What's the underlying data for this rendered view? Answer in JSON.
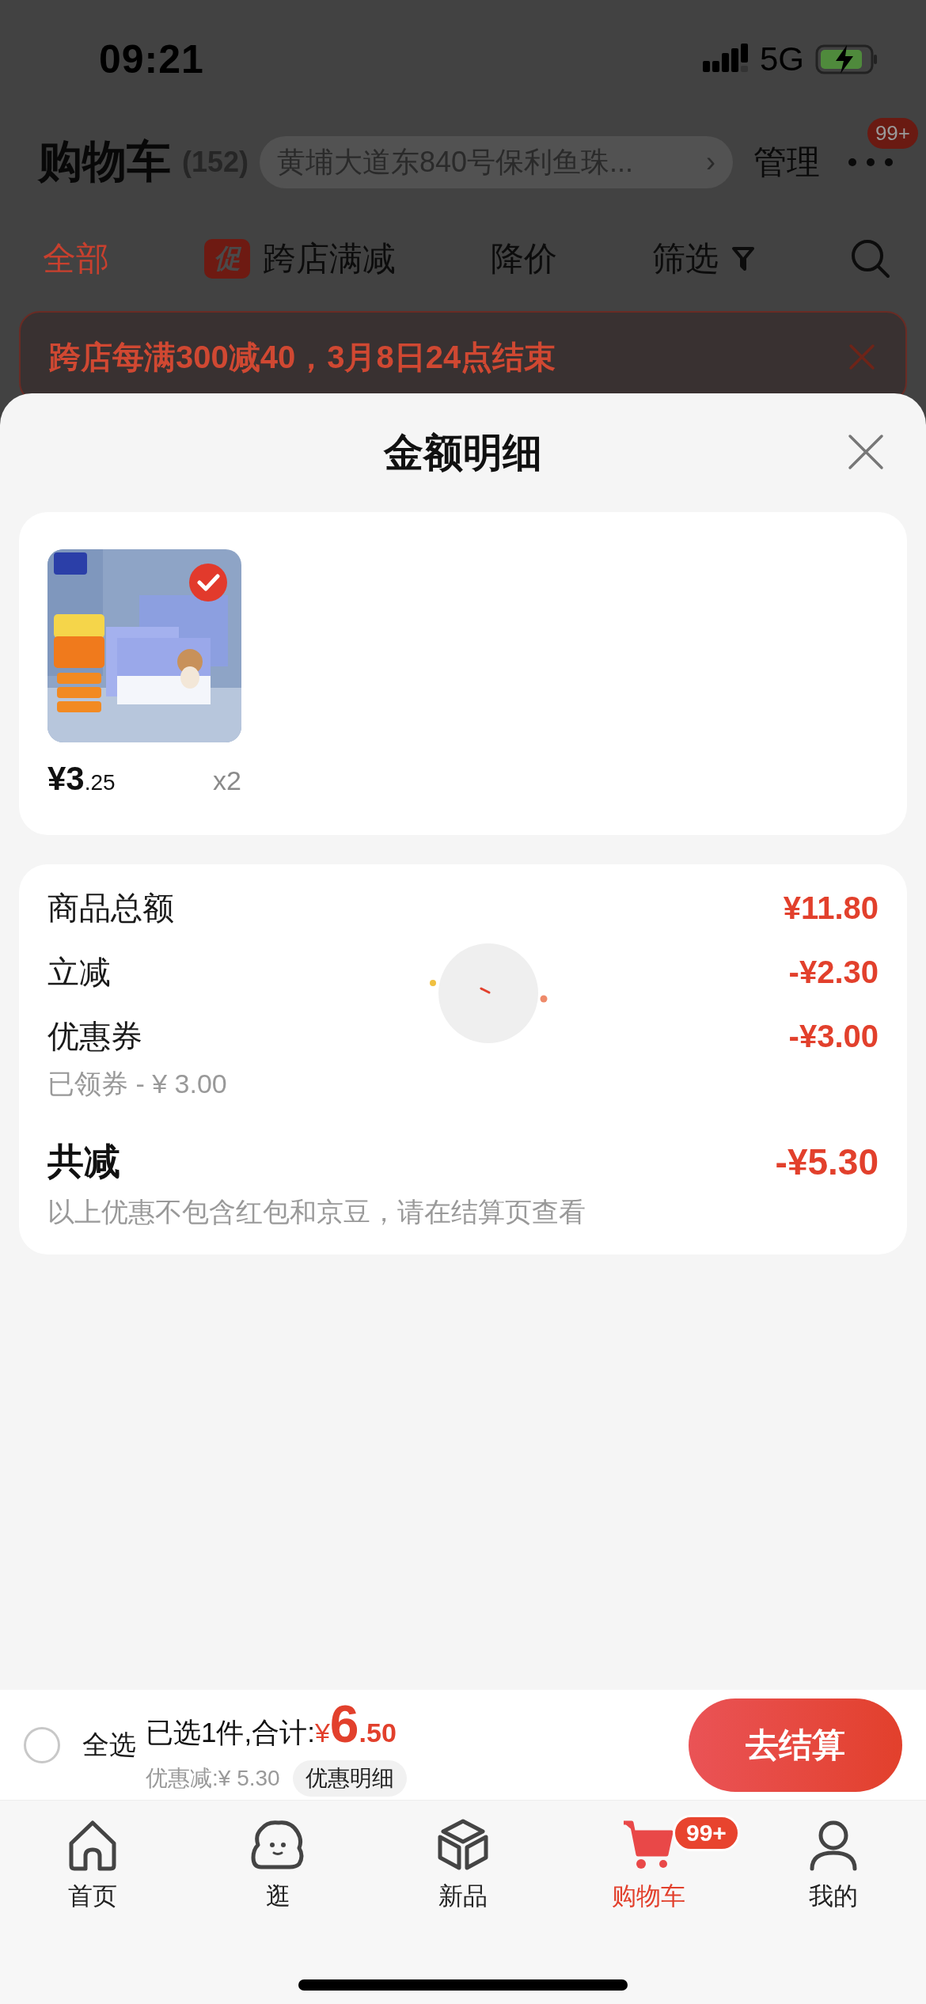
{
  "status_bar": {
    "time": "09:21",
    "network": "5G"
  },
  "header": {
    "title": "购物车",
    "count": "(152)",
    "address": "黄埔大道东840号保利鱼珠...",
    "address_arrow": "›",
    "manage": "管理",
    "more_badge": "99+"
  },
  "filter_tabs": [
    {
      "label": "全部",
      "selected": true
    },
    {
      "label": "跨店满减",
      "badge": "促",
      "selected": false
    },
    {
      "label": "降价",
      "selected": false
    },
    {
      "label": "筛选",
      "selected": false,
      "kind": "filter"
    }
  ],
  "promo_banner": {
    "text": "跨店每满300减40，3月8日24点结束"
  },
  "sheet": {
    "title": "金额明细",
    "products": [
      {
        "kind": "picture",
        "checked": true,
        "price_main": "¥3",
        "price_cents": ".25",
        "quantity": "x2"
      }
    ],
    "breakdown": [
      {
        "label": "商品总额",
        "amount": "¥11.80",
        "kind": "normal"
      },
      {
        "label": "立减",
        "amount": "-¥2.30",
        "kind": "normal"
      },
      {
        "label": "优惠券",
        "amount": "-¥3.00",
        "note": "已领券 - ¥ 3.00",
        "kind": "normal"
      },
      {
        "label": "共减",
        "amount": "-¥5.30",
        "note": "以上优惠不包含红包和京豆，请在结算页查看",
        "kind": "total"
      }
    ]
  },
  "checkout_bar": {
    "select_all": {
      "label": "全选",
      "checked": false
    },
    "summary": "已选1件,合计:",
    "currency": "¥",
    "total_main": "6",
    "total_cents": ".50",
    "discount": "优惠减:¥ 5.30",
    "details_button": "优惠明细",
    "checkout_button": "去结算"
  },
  "tab_bar": [
    {
      "label": "首页",
      "kind": "home",
      "selected": false
    },
    {
      "label": "逛",
      "kind": "browse",
      "selected": false
    },
    {
      "label": "新品",
      "kind": "new",
      "selected": false
    },
    {
      "label": "购物车",
      "kind": "cart",
      "selected": true,
      "badge": "99+"
    },
    {
      "label": "我的",
      "kind": "profile",
      "selected": false
    }
  ]
}
